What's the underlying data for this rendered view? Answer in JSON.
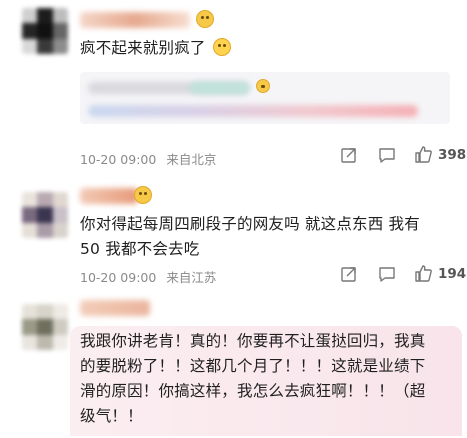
{
  "comments": [
    {
      "text": "疯不起来就别疯了",
      "timestamp": "10-20 09:00",
      "location": "来自北京",
      "likes": "398",
      "avatar_icon": "blurred-avatar",
      "inline_emoji": "crying-emoji"
    },
    {
      "text_line1": "你对得起每周四刷段子的网友吗 就这点东西 我有",
      "text_line2": "50 我都不会去吃",
      "timestamp": "10-20 09:00",
      "location": "来自江苏",
      "likes": "194",
      "avatar_icon": "blurred-avatar"
    },
    {
      "text_line1": "我跟你讲老肯！真的！你要再不让蛋挞回归，我真",
      "text_line2": "的要脱粉了！！这都几个月了！！！这就是业绩下",
      "text_line3": "滑的原因！你搞这样，我怎么去疯狂啊！！！（超",
      "text_line4": "级气！！",
      "avatar_icon": "blurred-avatar",
      "highlight_color": "#f8e4ea"
    }
  ],
  "colors": {
    "meta_text": "#8a8a8a",
    "quote_bg": "#f5f5f7",
    "pink_bg": "#f8e4ea"
  }
}
